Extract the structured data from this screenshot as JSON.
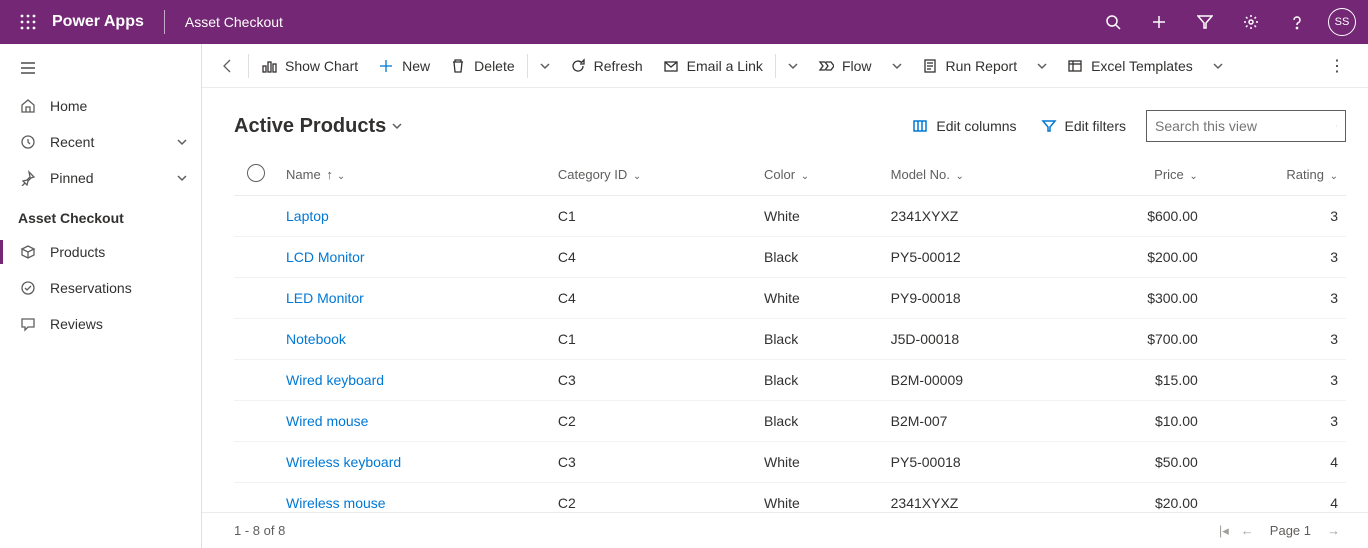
{
  "header": {
    "app_name": "Power Apps",
    "page_name": "Asset Checkout",
    "avatar": "SS"
  },
  "sidebar": {
    "home": "Home",
    "recent": "Recent",
    "pinned": "Pinned",
    "section": "Asset Checkout",
    "products": "Products",
    "reservations": "Reservations",
    "reviews": "Reviews"
  },
  "cmd": {
    "show_chart": "Show Chart",
    "new": "New",
    "delete": "Delete",
    "refresh": "Refresh",
    "email_link": "Email a Link",
    "flow": "Flow",
    "run_report": "Run Report",
    "excel": "Excel Templates"
  },
  "view": {
    "title": "Active Products",
    "edit_columns": "Edit columns",
    "edit_filters": "Edit filters",
    "search_placeholder": "Search this view"
  },
  "columns": {
    "name": "Name",
    "category": "Category ID",
    "color": "Color",
    "model": "Model No.",
    "price": "Price",
    "rating": "Rating"
  },
  "rows": [
    {
      "name": "Laptop",
      "category": "C1",
      "color": "White",
      "model": "2341XYXZ",
      "price": "$600.00",
      "rating": "3"
    },
    {
      "name": "LCD Monitor",
      "category": "C4",
      "color": "Black",
      "model": "PY5-00012",
      "price": "$200.00",
      "rating": "3"
    },
    {
      "name": "LED Monitor",
      "category": "C4",
      "color": "White",
      "model": "PY9-00018",
      "price": "$300.00",
      "rating": "3"
    },
    {
      "name": "Notebook",
      "category": "C1",
      "color": "Black",
      "model": "J5D-00018",
      "price": "$700.00",
      "rating": "3"
    },
    {
      "name": "Wired keyboard",
      "category": "C3",
      "color": "Black",
      "model": "B2M-00009",
      "price": "$15.00",
      "rating": "3"
    },
    {
      "name": "Wired mouse",
      "category": "C2",
      "color": "Black",
      "model": "B2M-007",
      "price": "$10.00",
      "rating": "3"
    },
    {
      "name": "Wireless keyboard",
      "category": "C3",
      "color": "White",
      "model": "PY5-00018",
      "price": "$50.00",
      "rating": "4"
    },
    {
      "name": "Wireless mouse",
      "category": "C2",
      "color": "White",
      "model": "2341XYXZ",
      "price": "$20.00",
      "rating": "4"
    }
  ],
  "footer": {
    "count": "1 - 8 of 8",
    "page": "Page 1"
  }
}
